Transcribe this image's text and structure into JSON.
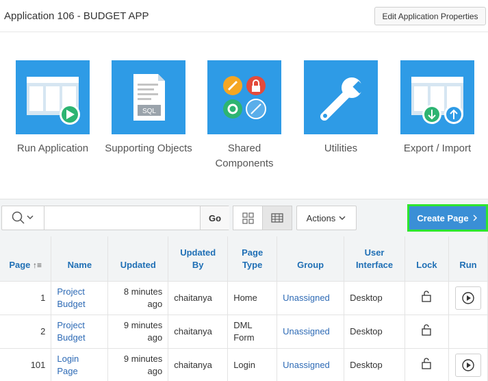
{
  "header": {
    "title": "Application 106 - BUDGET APP",
    "edit_button": "Edit Application Properties"
  },
  "tiles": [
    {
      "label": "Run Application",
      "icon": "run-application-icon"
    },
    {
      "label": "Supporting Objects",
      "icon": "sql-document-icon",
      "icon_text": "SQL"
    },
    {
      "label_line1": "Shared",
      "label_line2": "Components",
      "icon": "shared-components-icon"
    },
    {
      "label": "Utilities",
      "icon": "wrench-icon"
    },
    {
      "label": "Export / Import",
      "icon": "export-import-icon"
    }
  ],
  "toolbar": {
    "search_placeholder": "",
    "go_label": "Go",
    "actions_label": "Actions",
    "create_label": "Create Page"
  },
  "table": {
    "headers": {
      "page": "Page",
      "name": "Name",
      "updated": "Updated",
      "updated_by_1": "Updated",
      "updated_by_2": "By",
      "page_type_1": "Page",
      "page_type_2": "Type",
      "group": "Group",
      "ui_1": "User",
      "ui_2": "Interface",
      "lock": "Lock",
      "run": "Run"
    },
    "rows": [
      {
        "page": "1",
        "name1": "Project",
        "name2": "Budget",
        "updated1": "8 minutes",
        "updated2": "ago",
        "by": "chaitanya",
        "type1": "Home",
        "type2": "",
        "group": "Unassigned",
        "ui": "Desktop"
      },
      {
        "page": "2",
        "name1": "Project",
        "name2": "Budget",
        "updated1": "9 minutes",
        "updated2": "ago",
        "by": "chaitanya",
        "type1": "DML",
        "type2": "Form",
        "group": "Unassigned",
        "ui": "Desktop"
      },
      {
        "page": "101",
        "name1": "Login",
        "name2": "Page",
        "updated1": "9 minutes",
        "updated2": "ago",
        "by": "chaitanya",
        "type1": "Login",
        "type2": "",
        "group": "Unassigned",
        "ui": "Desktop"
      }
    ]
  },
  "colors": {
    "tile_blue": "#2e9be6",
    "create_blue": "#3a8fd6",
    "highlight_green": "#2ee62e",
    "link_blue": "#2d6ab5"
  }
}
